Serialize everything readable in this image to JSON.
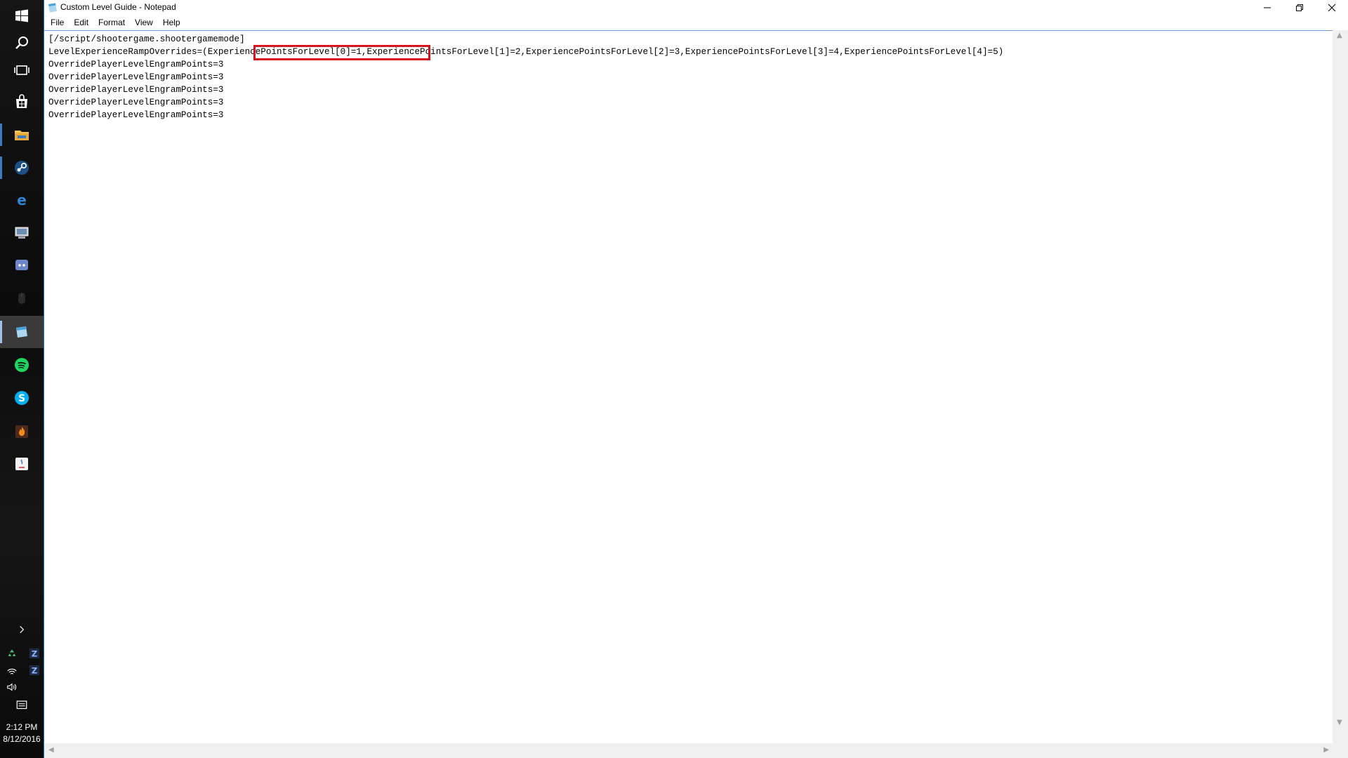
{
  "window": {
    "title": "Custom Level Guide - Notepad",
    "menu": [
      "File",
      "Edit",
      "Format",
      "View",
      "Help"
    ]
  },
  "editor": {
    "lines": [
      "[/script/shootergame.shootergamemode]",
      "LevelExperienceRampOverrides=(ExperiencePointsForLevel[0]=1,ExperiencePointsForLevel[1]=2,ExperiencePointsForLevel[2]=3,ExperiencePointsForLevel[3]=4,ExperiencePointsForLevel[4]=5)",
      "OverridePlayerLevelEngramPoints=3",
      "OverridePlayerLevelEngramPoints=3",
      "OverridePlayerLevelEngramPoints=3",
      "OverridePlayerLevelEngramPoints=3",
      "OverridePlayerLevelEngramPoints=3"
    ],
    "highlight_color": "#d8141c"
  },
  "taskbar": {
    "apps": [
      "windows-start-icon",
      "search-icon",
      "task-view-icon",
      "store-icon",
      "file-explorer-icon",
      "steam-icon",
      "edge-icon",
      "network-drive-icon",
      "discord-icon",
      "mouse-icon",
      "notepad-icon",
      "spotify-icon",
      "skype-icon",
      "flame-app-icon",
      "java-icon"
    ],
    "clock_time": "2:12 PM",
    "clock_date": "8/12/2016",
    "accent": "#3a7cc4"
  }
}
